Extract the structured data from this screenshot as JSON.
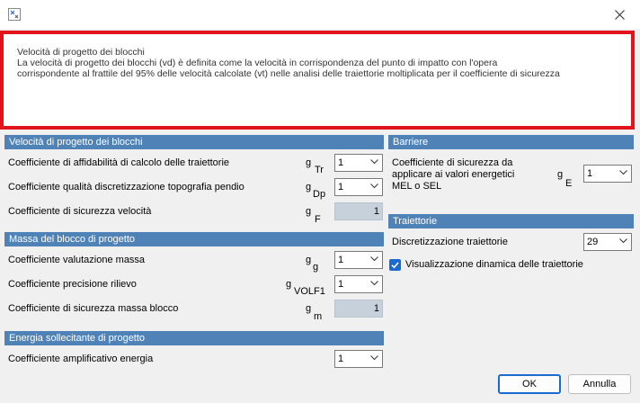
{
  "dialog": {
    "ok_label": "OK",
    "cancel_label": "Annulla"
  },
  "info": {
    "title": "Velocità di progetto dei blocchi",
    "line1": "La velocità di progetto dei blocchi (vd) è definita come la velocità in corrispondenza del punto di impatto con l'opera",
    "line2": "corrispondente al frattile del 95% delle velocità calcolate (vt) nelle analisi delle traiettorie moltiplicata per il coefficiente di sicurezza"
  },
  "velocity": {
    "header": "Velocità di progetto dei blocchi",
    "rows": [
      {
        "label": "Coefficiente di affidabilità di calcolo delle traiettorie",
        "sym": "g",
        "sub": "Tr",
        "value": "1"
      },
      {
        "label": "Coefficiente qualità discretizzazione topografia pendio",
        "sym": "g",
        "sub": "Dp",
        "value": "1"
      },
      {
        "label": "Coefficiente di sicurezza velocità",
        "sym": "g",
        "sub": "F",
        "value": "1"
      }
    ]
  },
  "mass": {
    "header": "Massa del blocco di progetto",
    "rows": [
      {
        "label": "Coefficiente valutazione massa",
        "sym": "g",
        "sub": "g",
        "value": "1"
      },
      {
        "label": "Coefficiente precisione rilievo",
        "sym": "g",
        "sub": "VOLF1",
        "value": "1"
      },
      {
        "label": "Coefficiente di sicurezza massa blocco",
        "sym": "g",
        "sub": "m",
        "value": "1"
      }
    ]
  },
  "energy": {
    "header": "Energia sollecitante di progetto",
    "rows": [
      {
        "label": "Coefficiente amplificativo energia",
        "value": "1"
      }
    ]
  },
  "barriers": {
    "header": "Barriere",
    "label_line1": "Coefficiente di sicurezza da",
    "label_line2": "applicare ai valori energetici",
    "label_line3": "MEL o SEL",
    "sym": "g",
    "sub": "E",
    "value": "1"
  },
  "trajectories": {
    "header": "Traiettorie",
    "discretization_label": "Discretizzazione traiettorie",
    "discretization_value": "29",
    "dynamic_label": "Visualizzazione dinamica delle traiettorie"
  },
  "colors": {
    "header_bg": "#4f83b8",
    "highlight_border": "#e0141a",
    "accent": "#1a6bd1"
  }
}
